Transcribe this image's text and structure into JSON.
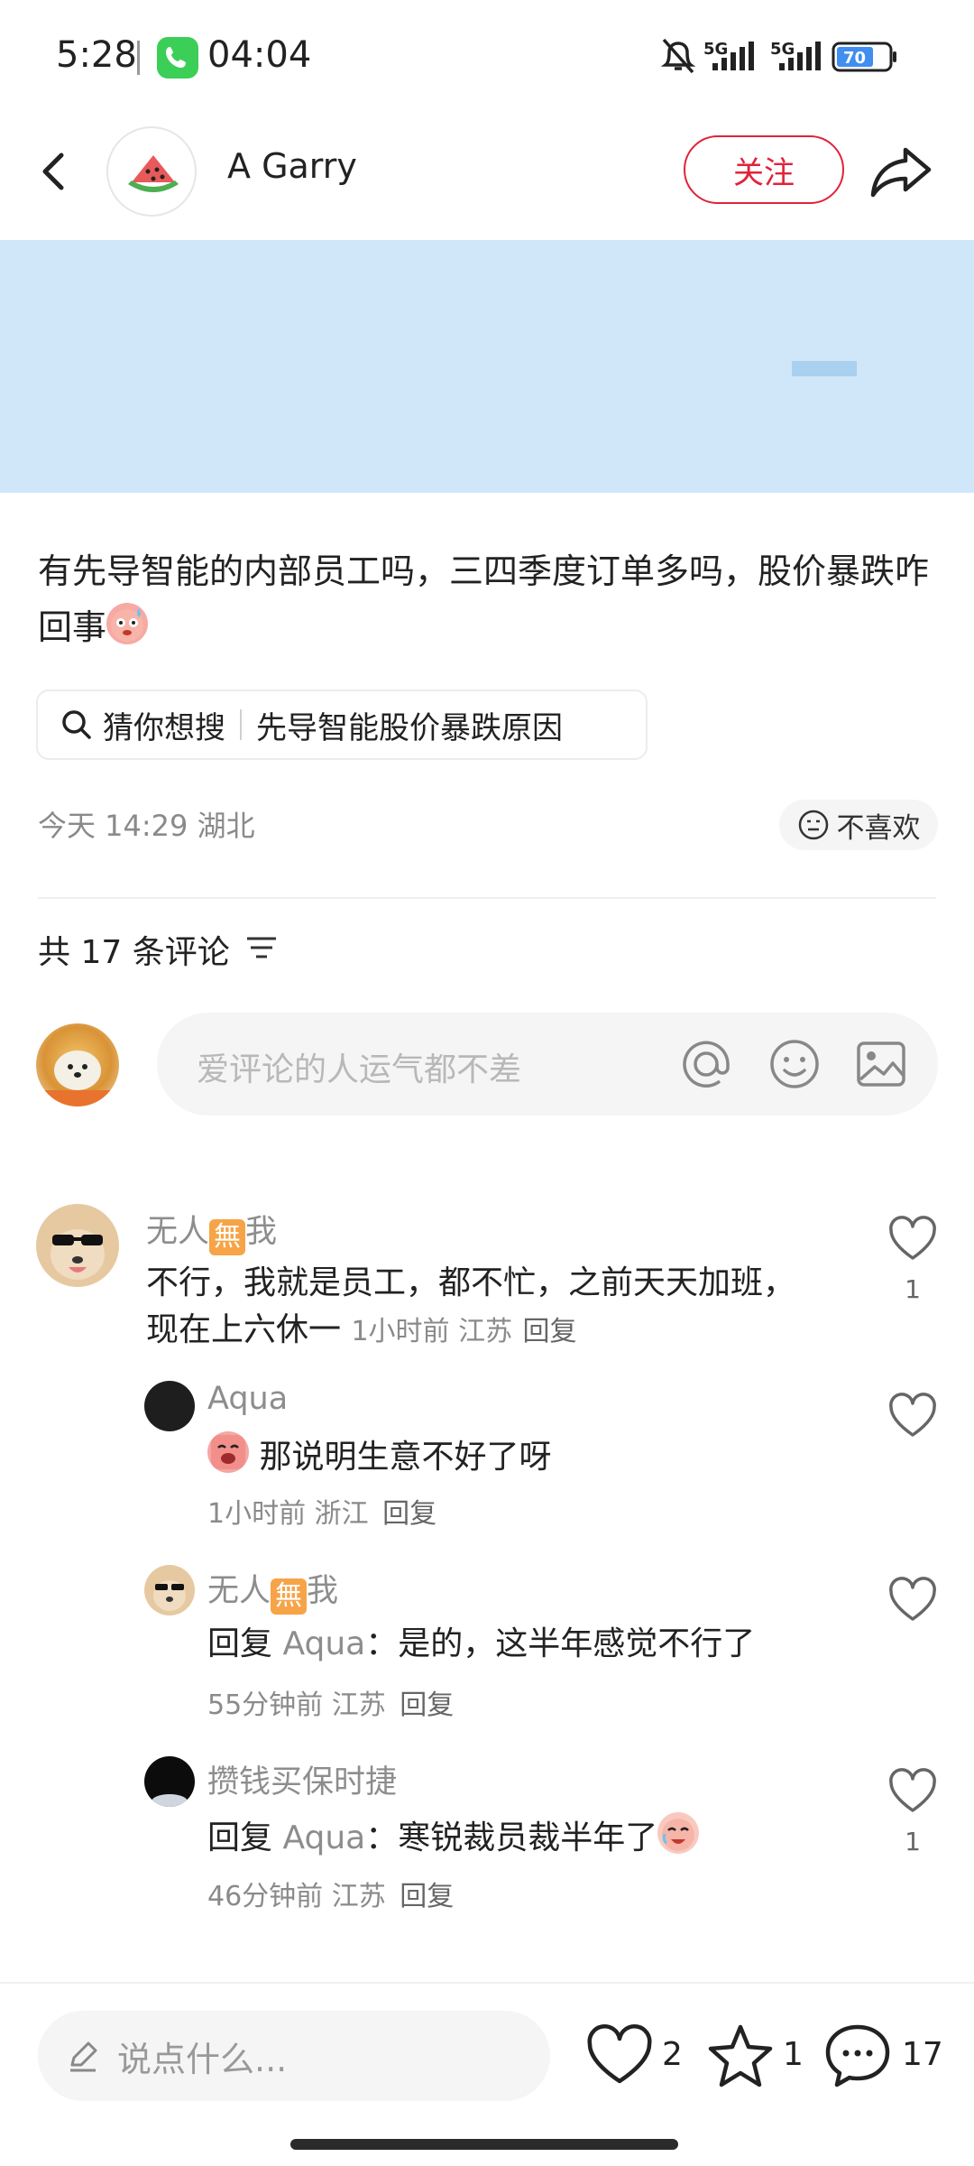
{
  "status_bar": {
    "time": "5:28",
    "call_time": "04:04",
    "network_1": "5G",
    "network_2": "5G",
    "battery": "70"
  },
  "header": {
    "author_name": "A Garry",
    "follow_label": "关注"
  },
  "post": {
    "text": "有先导智能的内部员工吗，三四季度订单多吗，股价暴跌咋回事",
    "guess_label": "猜你想搜",
    "guess_query": "先导智能股价暴跌原因",
    "meta": "今天 14:29 湖北",
    "dislike_label": "不喜欢"
  },
  "comments_section": {
    "count_label": "共 17 条评论",
    "input_placeholder": "爱评论的人运气都不差"
  },
  "comments": [
    {
      "name_prefix": "无人",
      "name_tag": "無",
      "name_suffix": "我",
      "text": "不行，我就是员工，都不忙，之前天天加班，现在上六休一",
      "meta": "1小时前 江苏",
      "reply_label": "回复",
      "like_count": "1"
    }
  ],
  "replies": [
    {
      "name": "Aqua",
      "text": "那说明生意不好了呀",
      "meta": "1小时前 浙江",
      "reply_label": "回复",
      "like_count": ""
    },
    {
      "name_prefix": "无人",
      "name_tag": "無",
      "name_suffix": "我",
      "reply_prefix": "回复",
      "reply_to": "Aqua",
      "text": "：是的，这半年感觉不行了",
      "meta": "55分钟前 江苏",
      "reply_label": "回复",
      "like_count": ""
    },
    {
      "name": "攒钱买保时捷",
      "reply_prefix": "回复",
      "reply_to": "Aqua",
      "text": "：寒锐裁员裁半年了",
      "meta": "46分钟前 江苏",
      "reply_label": "回复",
      "like_count": "1"
    }
  ],
  "bottom_bar": {
    "say_placeholder": "说点什么...",
    "like_count": "2",
    "star_count": "1",
    "comment_count": "17"
  },
  "colors": {
    "accent_red": "#e0233a",
    "banner_blue": "#cfe7f8",
    "muted_text": "#8d8d8d"
  }
}
